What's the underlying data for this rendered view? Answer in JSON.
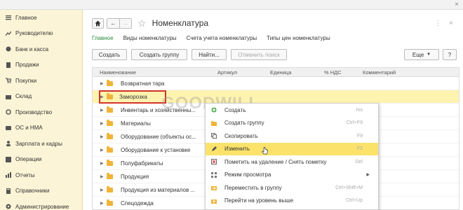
{
  "sidebar": {
    "items": [
      {
        "label": "Главное",
        "icon": "menu-icon"
      },
      {
        "label": "Руководителю",
        "icon": "chart-icon"
      },
      {
        "label": "Банк и касса",
        "icon": "bank-icon"
      },
      {
        "label": "Продажи",
        "icon": "sales-icon"
      },
      {
        "label": "Покупки",
        "icon": "cart-icon"
      },
      {
        "label": "Склад",
        "icon": "warehouse-icon"
      },
      {
        "label": "Производство",
        "icon": "factory-icon"
      },
      {
        "label": "ОС и НМА",
        "icon": "assets-icon"
      },
      {
        "label": "Зарплата и кадры",
        "icon": "people-icon"
      },
      {
        "label": "Операции",
        "icon": "operations-icon"
      },
      {
        "label": "Отчеты",
        "icon": "reports-icon"
      },
      {
        "label": "Справочники",
        "icon": "catalog-icon"
      },
      {
        "label": "Администрирование",
        "icon": "admin-icon"
      }
    ]
  },
  "header": {
    "title": "Номенклатура"
  },
  "tabs": [
    {
      "label": "Главное",
      "active": true
    },
    {
      "label": "Виды номенклатуры",
      "active": false
    },
    {
      "label": "Счета учета номенклатуры",
      "active": false
    },
    {
      "label": "Типы цен номенклатуры",
      "active": false
    }
  ],
  "toolbar": {
    "create": "Создать",
    "create_group": "Создать группу",
    "find": "Найти...",
    "cancel_search": "Отменить поиск",
    "more": "Еще",
    "help": "?"
  },
  "table": {
    "columns": [
      "Наименование",
      "Артикул",
      "Единица",
      "% НДС",
      "Комментарий"
    ],
    "rows": [
      "Возвратная тара",
      "Заморозка",
      "Инвентарь и хозяйственны...",
      "Материалы",
      "Оборудование (объекты ос...",
      "Оборудование к установке",
      "Полуфабрикаты",
      "Продукция",
      "Продукция из материалов ...",
      "Спецодежда"
    ],
    "selected_row": "Заморозка"
  },
  "watermark": "GOODWILL",
  "context_menu": {
    "items": [
      {
        "label": "Создать",
        "shortcut": "Ins",
        "icon": "create-icon"
      },
      {
        "label": "Создать группу",
        "shortcut": "Ctrl+F9",
        "icon": "folder-plus-icon"
      },
      {
        "label": "Скопировать",
        "shortcut": "F9",
        "icon": "copy-icon"
      },
      {
        "label": "Изменить",
        "shortcut": "F2",
        "icon": "pencil-icon",
        "highlighted": true
      },
      {
        "label": "Пометить на удаление / Снять пометку",
        "shortcut": "Del",
        "icon": "delete-mark-icon"
      },
      {
        "label": "Режим просмотра",
        "shortcut": "",
        "icon": "view-mode-icon",
        "submenu": true
      },
      {
        "label": "Переместить в группу",
        "shortcut": "Ctrl+Shift+M",
        "icon": "move-icon"
      },
      {
        "label": "Перейти на уровень выше",
        "shortcut": "Ctrl+Up",
        "icon": "level-up-icon"
      }
    ]
  },
  "colors": {
    "sidebar_bg": "#fbf4d6",
    "active_tab": "#2a8a3a",
    "selection": "#fff3b0",
    "menu_highlight": "#fbe36b",
    "folder": "#f0b43a",
    "red_outline": "#d7342a"
  }
}
